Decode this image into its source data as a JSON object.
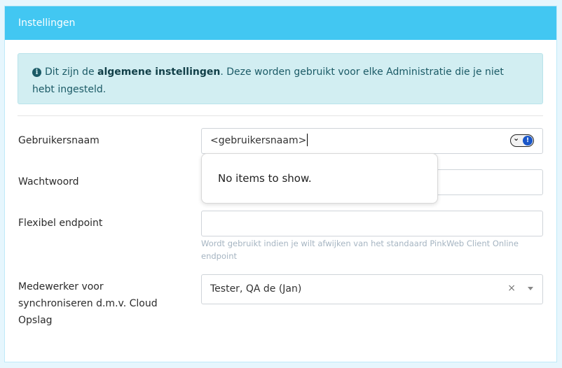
{
  "panel": {
    "title": "Instellingen"
  },
  "alert": {
    "icon": "info-circle-icon",
    "text_before": "Dit zijn de ",
    "text_bold": "algemene instellingen",
    "text_after": ". Deze worden gebruikt voor elke Administratie die je niet hebt ingesteld."
  },
  "form": {
    "username": {
      "label": "Gebruikersnaam",
      "value": "<gebruikersnaam>"
    },
    "password": {
      "label": "Wachtwoord",
      "value": ""
    },
    "endpoint": {
      "label": "Flexibel endpoint",
      "value": "",
      "help": "Wordt gebruikt indien je wilt afwijken van het standaard PinkWeb Client Online endpoint"
    },
    "employee": {
      "label": "Medewerker voor synchroniseren d.m.v. Cloud Opslag",
      "value": "Tester, QA de (Jan)",
      "clear": "×"
    }
  },
  "autocomplete": {
    "empty_text": "No items to show."
  },
  "colors": {
    "header": "#42c7f2",
    "alert_bg": "#d2eef2",
    "alert_text": "#1b5a66"
  }
}
